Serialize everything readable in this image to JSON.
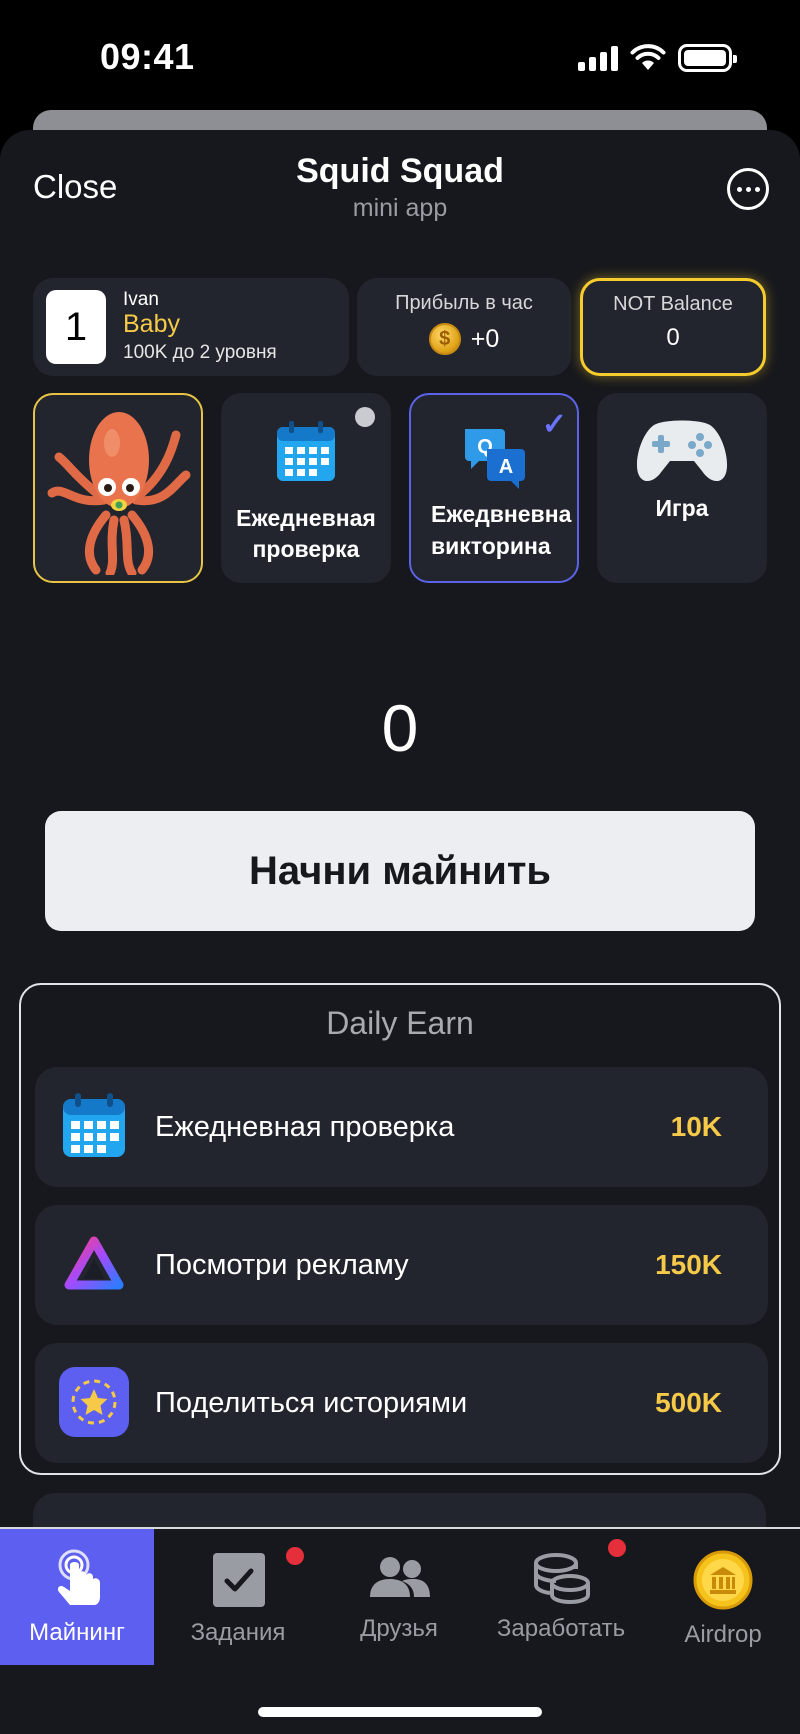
{
  "status_bar": {
    "time": "09:41"
  },
  "header": {
    "close_label": "Close",
    "title": "Squid Squad",
    "subtitle": "mini app"
  },
  "user": {
    "level": "1",
    "name": "Ivan",
    "rank": "Baby",
    "progress": "100K до 2 уровня"
  },
  "profit": {
    "label": "Прибыль в час",
    "value": "+0"
  },
  "balance": {
    "label": "NOT Balance",
    "value": "0"
  },
  "tiles": {
    "daily_check": {
      "line1": "Ежедневная",
      "line2": "проверка"
    },
    "daily_quiz": {
      "line1": "Ежедвневна",
      "line2": "викторина"
    },
    "game": {
      "label": "Игра"
    }
  },
  "counter": "0",
  "mine_button": "Начни майнить",
  "daily_earn": {
    "title": "Daily Earn",
    "rows": [
      {
        "label": "Ежедневная проверка",
        "value": "10K"
      },
      {
        "label": "Посмотри рекламу",
        "value": "150K"
      },
      {
        "label": "Поделиться историями",
        "value": "500K"
      }
    ]
  },
  "tabbar": {
    "tabs": [
      {
        "label": "Майнинг",
        "icon": "tap-icon",
        "active": true
      },
      {
        "label": "Задания",
        "icon": "checkbox-icon",
        "badge": true
      },
      {
        "label": "Друзья",
        "icon": "friends-icon"
      },
      {
        "label": "Заработать",
        "icon": "coins-icon",
        "badge": true
      },
      {
        "label": "Airdrop",
        "icon": "gold-coin-icon"
      }
    ]
  },
  "colors": {
    "accent": "#5c5fef",
    "gold": "#f7c948",
    "background": "#17181d",
    "card": "#22252d",
    "badge": "#e5303b"
  }
}
